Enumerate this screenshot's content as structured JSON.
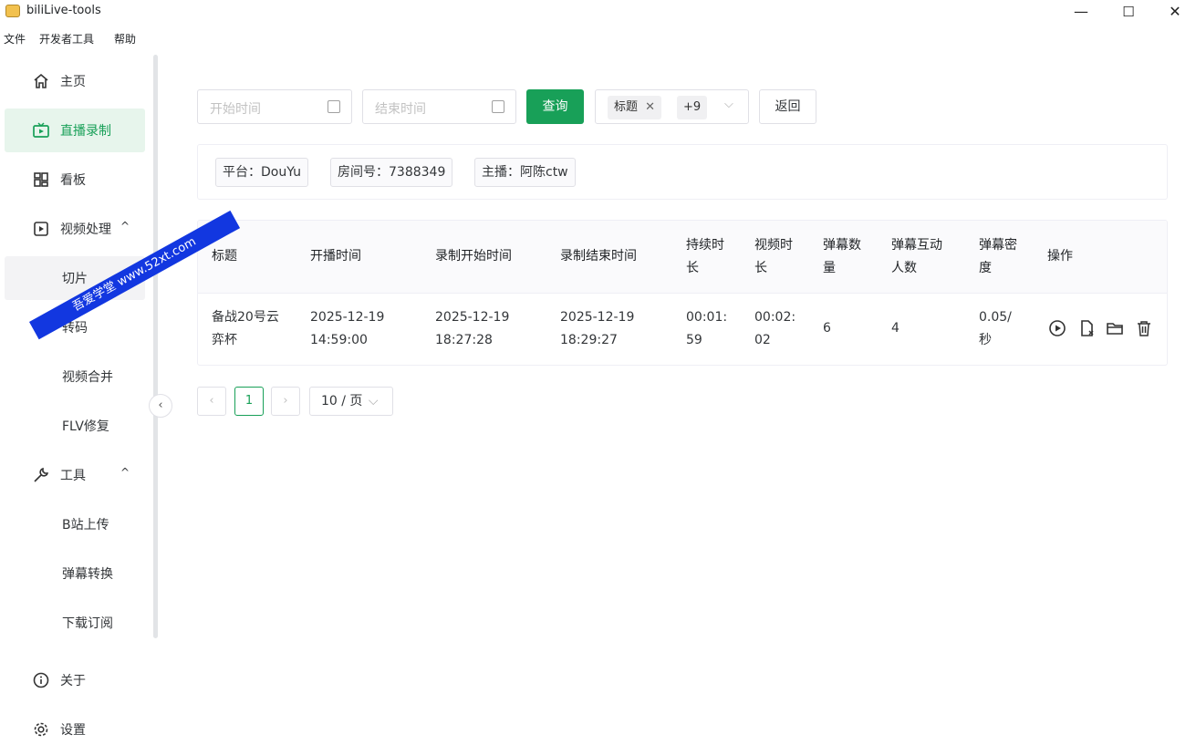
{
  "window": {
    "title": "biliLive-tools",
    "minimize": "—",
    "maximize": "☐",
    "close": "✕"
  },
  "menu": [
    "文件",
    "开发者工具",
    "帮助"
  ],
  "sidebar": {
    "items": [
      {
        "label": "主页",
        "icon": "home-icon"
      },
      {
        "label": "直播录制",
        "icon": "tv-icon"
      },
      {
        "label": "看板",
        "icon": "dashboard-icon"
      },
      {
        "label": "视频处理",
        "icon": "video-icon"
      },
      {
        "label": "切片"
      },
      {
        "label": "转码"
      },
      {
        "label": "视频合并"
      },
      {
        "label": "FLV修复"
      },
      {
        "label": "工具",
        "icon": "wrench-icon"
      },
      {
        "label": "B站上传"
      },
      {
        "label": "弹幕转换"
      },
      {
        "label": "下载订阅"
      },
      {
        "label": "关于",
        "icon": "info-icon"
      },
      {
        "label": "设置",
        "icon": "gear-icon"
      }
    ],
    "collapse": "‹"
  },
  "watermark": "吾爱学堂 www.52xt.com",
  "filters": {
    "start_placeholder": "开始时间",
    "end_placeholder": "结束时间",
    "query_label": "查询",
    "tag_title": "标题",
    "tag_close": "✕",
    "tag_more": "+9",
    "back_label": "返回"
  },
  "info": {
    "platform": "平台：DouYu",
    "room": "房间号：7388349",
    "streamer": "主播：阿陈ctw"
  },
  "table": {
    "headers": [
      [
        "标题"
      ],
      [
        "开播时间"
      ],
      [
        "录制开始时间"
      ],
      [
        "录制结束时间"
      ],
      [
        "持续时",
        "长"
      ],
      [
        "视频时",
        "长"
      ],
      [
        "弹幕数",
        "量"
      ],
      [
        "弹幕互动",
        "人数"
      ],
      [
        "弹幕密",
        "度"
      ],
      [
        "操作"
      ]
    ],
    "rows": [
      {
        "title": [
          "备战20号云",
          "弈杯"
        ],
        "live_start": [
          "2025-12-19",
          "14:59:00"
        ],
        "rec_start": [
          "2025-12-19",
          "18:27:28"
        ],
        "rec_end": [
          "2025-12-19",
          "18:29:27"
        ],
        "duration": [
          "00:01:",
          "59"
        ],
        "video_duration": [
          "00:02:",
          "02"
        ],
        "danmaku_count": "6",
        "danmaku_users": "4",
        "danmaku_density": [
          "0.05/",
          "秒"
        ]
      }
    ]
  },
  "pager": {
    "prev": "‹",
    "current": "1",
    "next": "›",
    "size": "10 / 页",
    "size_chevron": "⌵"
  },
  "colors": {
    "accent": "#18a058",
    "active_bg": "#e7f5ec",
    "watermark": "#1237e0"
  }
}
